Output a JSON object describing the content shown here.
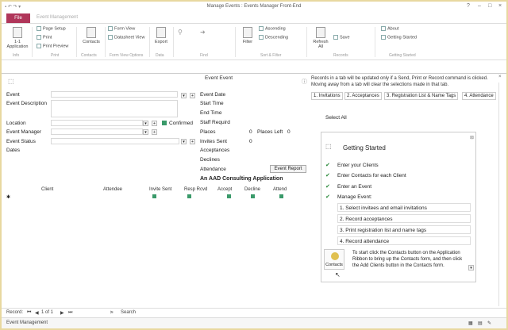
{
  "window": {
    "title": "Manage Events : Events Manager Front-End"
  },
  "ribbon": {
    "file_tab": "File",
    "faded_tab": "Event Management",
    "items": {
      "application": "1-1\nApplication",
      "page_setup": "Page Setup",
      "print": "Print",
      "print_preview": "Print Preview",
      "contacts": "Contacts",
      "form_view": "Form View",
      "datasheet_view": "Datasheet View",
      "export": "Export",
      "filter": "Filter",
      "ascending": "Ascending",
      "descending": "Descending",
      "refresh_all": "Refresh\nAll",
      "save": "Save",
      "about": "About",
      "getting_started": "Getting Started"
    },
    "groups": {
      "g1": "Info",
      "g2": "Print",
      "g3": "Contacts",
      "g4": "Form View Options",
      "g5": "Data",
      "g6": "Find",
      "g7": "Sort & Filter",
      "g8": "Records",
      "g9": "Getting Started"
    }
  },
  "form": {
    "header": "Event Event",
    "close": "×",
    "left_fields": {
      "event": "Event",
      "event_description": "Event Description",
      "location": "Location",
      "event_manager": "Event Manager",
      "event_status": "Event Status",
      "dates": "Dates"
    },
    "confirmed": "Confirmed",
    "mid_fields": {
      "event_date": "Event Date",
      "start_time": "Start Time",
      "end_time": "End Time",
      "staff_required": "Staff Requird",
      "places": "Places",
      "places_value": "0",
      "places_left": "Places Left",
      "places_left_value": "0",
      "invites_sent": "Invites Sent",
      "invites_sent_value": "0",
      "acceptances": "Acceptances",
      "declines": "Declines",
      "attendance": "Attendance"
    },
    "event_report_button": "Event Report",
    "consulting": "An AAD Consulting Application",
    "grid_headers": [
      "Client",
      "Attendee",
      "Invite Sent",
      "Resp Rcvd",
      "Accept",
      "Decline",
      "Attend"
    ]
  },
  "notice": "Records in a tab will be updated only if a Send, Print or Record command is clicked.  Moving away from a tab will clear the selections made in that tab.",
  "right_tabs": [
    "1. Invitations",
    "2. Acceptances",
    "3. Registration List & Name Tags",
    "4. Attendance"
  ],
  "select_all": "Select All",
  "getting_started": {
    "title": "Getting Started",
    "checks": [
      "Enter your Clients",
      "Enter Contacts for each Client",
      "Enter an Event",
      "Manage Event:"
    ],
    "steps": [
      "1. Select invitees and email invitations",
      "2. Record acceptances",
      "3. Print registration list and name tags",
      "4. Record attendance"
    ],
    "contacts_label": "Contacts",
    "instruction": "To start click  the Contacts button on the Application Ribbon to bring up the Contacts form, and then click the Add Clients button in the Contacts form."
  },
  "navbar": {
    "record_label": "Record:",
    "record_value": "1 of 1",
    "search": "Search"
  },
  "status": {
    "left": "Event Management"
  }
}
